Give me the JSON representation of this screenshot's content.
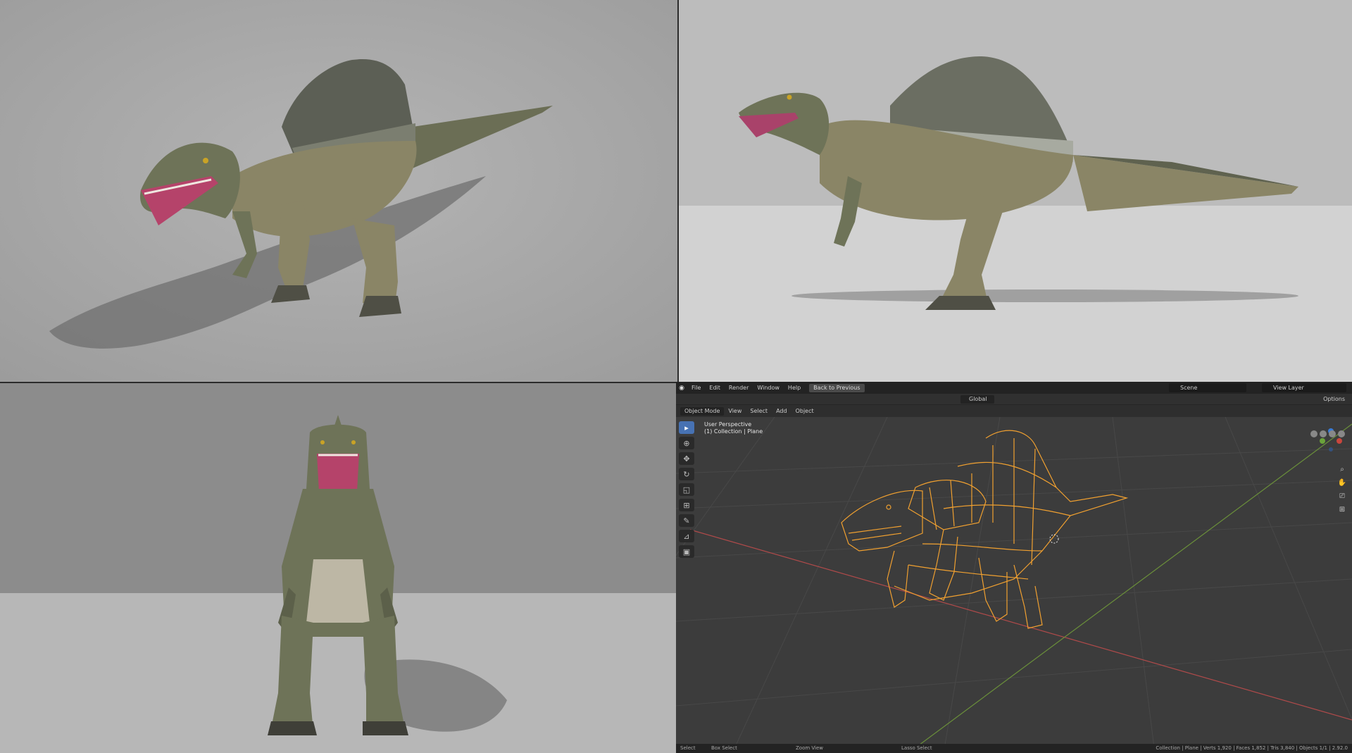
{
  "blender": {
    "menu": [
      "File",
      "Edit",
      "Render",
      "Window",
      "Help"
    ],
    "back_button": "Back to Previous",
    "scene": "Scene",
    "view_layer": "View Layer",
    "orientation": "Global",
    "options": "Options",
    "mode": "Object Mode",
    "view_menu": [
      "View",
      "Select",
      "Add",
      "Object"
    ],
    "viewport_title": "User Perspective",
    "viewport_collection": "(1) Collection | Plane",
    "status": {
      "select": "Select",
      "box_select": "Box Select",
      "zoom_view": "Zoom View",
      "lasso_select": "Lasso Select",
      "stats": "Collection | Plane | Verts 1,920 | Faces 1,852 | Tris 3,840 | Objects 1/1 | 2.92.0"
    },
    "colors": {
      "wire": "#f0a030",
      "active_tool": "#4772b3",
      "x_axis": "#b04a4a",
      "y_axis": "#6a8f3a"
    },
    "tools": [
      "select-box-icon",
      "cursor-icon",
      "move-icon",
      "rotate-icon",
      "scale-icon",
      "transform-icon",
      "annotate-icon",
      "measure-icon",
      "add-cube-icon"
    ],
    "nav": [
      "zoom-icon",
      "pan-icon",
      "camera-icon",
      "grid-icon"
    ]
  }
}
